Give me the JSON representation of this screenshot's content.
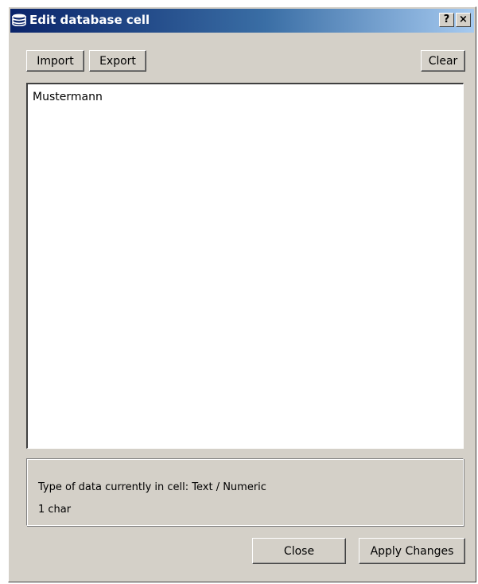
{
  "window": {
    "title": "Edit database cell",
    "help_label": "?",
    "close_label": "×"
  },
  "toolbar": {
    "import_label": "Import",
    "export_label": "Export",
    "clear_label": "Clear"
  },
  "editor": {
    "value": "Mustermann"
  },
  "info": {
    "type_text": "Type of data currently in cell: Text / Numeric",
    "size_text": "1 char"
  },
  "footer": {
    "close_label": "Close",
    "apply_label": "Apply Changes"
  },
  "colors": {
    "titlebar_start": "#0a246a",
    "titlebar_end": "#a6caf0",
    "dialog_bg": "#d4d0c8"
  },
  "icons": {
    "title": "database-icon"
  }
}
